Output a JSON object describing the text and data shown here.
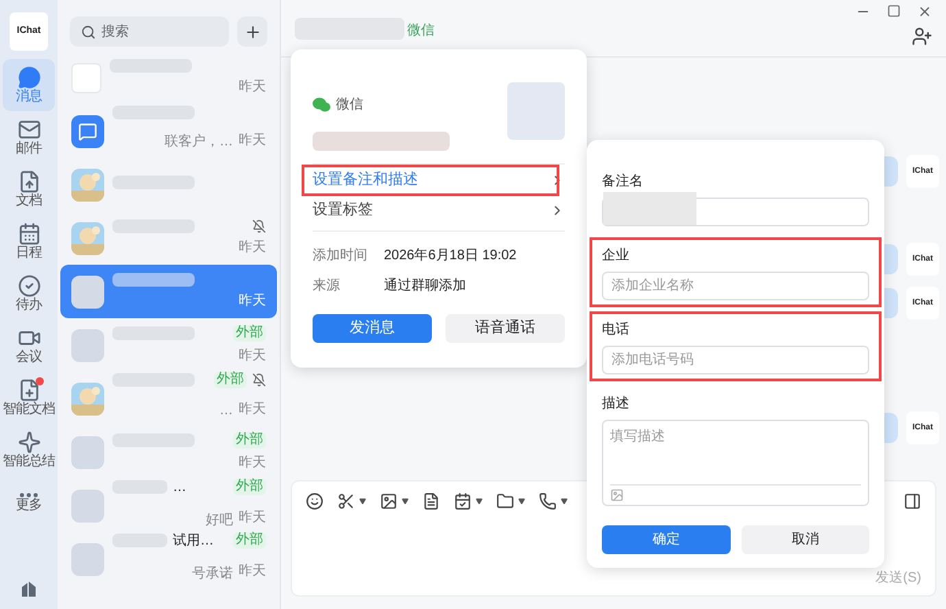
{
  "nav": {
    "logo": "IChat",
    "items": [
      {
        "label": "消息",
        "selected": true,
        "badge": false
      },
      {
        "label": "邮件",
        "selected": false,
        "badge": false
      },
      {
        "label": "文档",
        "selected": false,
        "badge": false
      },
      {
        "label": "日程",
        "selected": false,
        "badge": false
      },
      {
        "label": "待办",
        "selected": false,
        "badge": false
      },
      {
        "label": "会议",
        "selected": false,
        "badge": false
      },
      {
        "label": "智能文档",
        "selected": false,
        "badge": true
      },
      {
        "label": "智能总结",
        "selected": false,
        "badge": false
      },
      {
        "label": "更多",
        "selected": false,
        "badge": false
      }
    ]
  },
  "chat_list": {
    "search_placeholder": "搜索",
    "rows": [
      {
        "kind": "logo",
        "time": "昨天",
        "muted": false,
        "selected": false
      },
      {
        "kind": "chat",
        "snippet": "联客户，…",
        "time": "昨天",
        "muted": false,
        "selected": false
      },
      {
        "kind": "picture",
        "muted": false,
        "selected": false
      },
      {
        "kind": "picture",
        "time": "昨天",
        "muted": true,
        "selected": false
      },
      {
        "kind": "blank",
        "time": "昨天",
        "muted": false,
        "selected": true
      },
      {
        "kind": "blank",
        "tag": "外部",
        "time": "昨天",
        "muted": false,
        "selected": false
      },
      {
        "kind": "picture",
        "tag": "外部",
        "snippet": "…",
        "time": "昨天",
        "muted": true,
        "selected": false
      },
      {
        "kind": "blank",
        "tag": "外部",
        "time": "昨天",
        "muted": false,
        "selected": false
      },
      {
        "kind": "blank",
        "title": "…",
        "tag": "外部",
        "snippet": "好吧",
        "time": "昨天",
        "muted": false,
        "selected": false
      },
      {
        "kind": "blank",
        "title": "试用…",
        "tag": "外部",
        "snippet": "号承诺",
        "time": "昨天",
        "muted": false,
        "selected": false
      }
    ]
  },
  "header": {
    "source_tag": "微信"
  },
  "messages": [
    {
      "avatar": "IChat"
    },
    {
      "avatar": "IChat"
    },
    {
      "avatar": "IChat"
    },
    {
      "avatar": "IChat"
    }
  ],
  "profile_card": {
    "source": "微信",
    "menu": [
      {
        "label": "设置备注和描述",
        "selected": true,
        "highlighted": true
      },
      {
        "label": "设置标签",
        "selected": false,
        "highlighted": false
      }
    ],
    "info": [
      {
        "label": "添加时间",
        "value": "2026年6月18日 19:02"
      },
      {
        "label": "来源",
        "value": "通过群聊添加"
      }
    ],
    "buttons": [
      {
        "label": "发消息",
        "kind": "primary"
      },
      {
        "label": "语音通话",
        "kind": "secondary"
      }
    ]
  },
  "edit_dialog": {
    "fields": [
      {
        "label": "备注名",
        "kind": "redacted",
        "highlighted": false
      },
      {
        "label": "企业",
        "kind": "input",
        "placeholder": "添加企业名称",
        "highlighted": true
      },
      {
        "label": "电话",
        "kind": "input",
        "placeholder": "添加电话号码",
        "highlighted": true
      },
      {
        "label": "描述",
        "kind": "textarea",
        "placeholder": "填写描述",
        "highlighted": false
      }
    ],
    "buttons": [
      {
        "label": "确定",
        "kind": "primary"
      },
      {
        "label": "取消",
        "kind": "secondary"
      }
    ]
  },
  "composer": {
    "send": "发送(S)"
  }
}
